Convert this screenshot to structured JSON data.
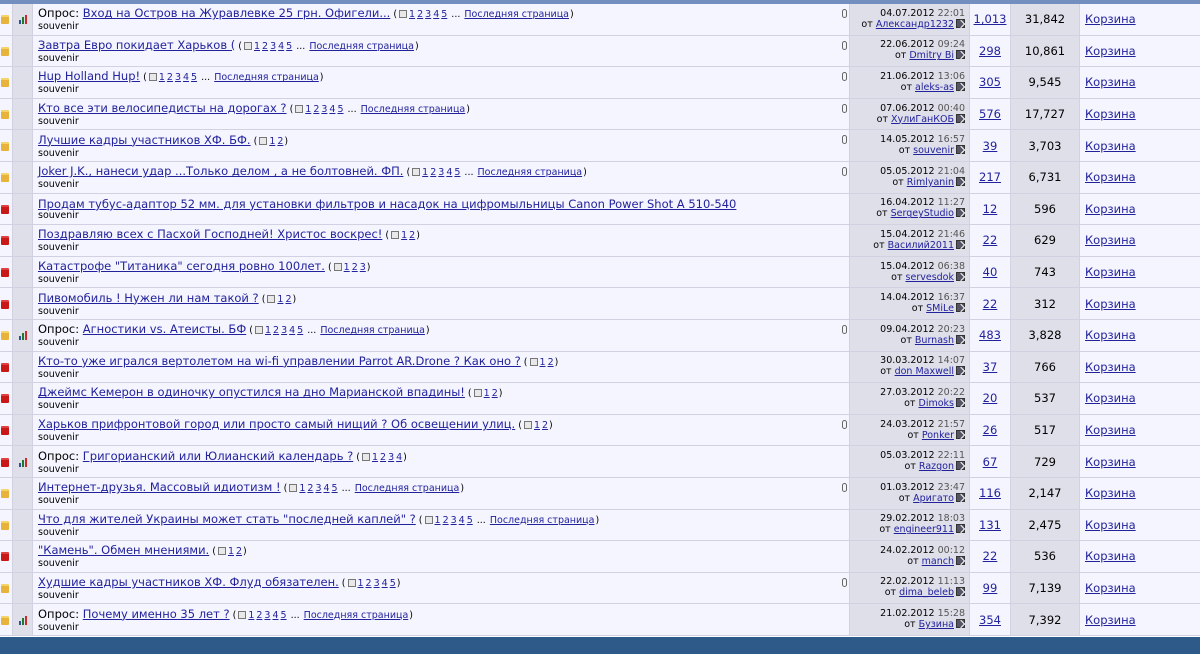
{
  "pages_word": "Последняя страница",
  "poll_prefix": "Опрос:",
  "by_prefix": "от",
  "threads": [
    {
      "poll": true,
      "hot": true,
      "clip": true,
      "title": "Вход на Остров на Журавлевке 25 грн. Офигели...",
      "pages": [
        "1",
        "2",
        "3",
        "4",
        "5"
      ],
      "has_last": true,
      "author": "souvenir",
      "date": "04.07.2012",
      "time": "22:01",
      "last_by": "Александр1232",
      "replies": "1,013",
      "views": "31,842",
      "category": "Корзина"
    },
    {
      "poll": false,
      "hot": true,
      "clip": true,
      "title": "Завтра Евро покидает Харьков (",
      "pages": [
        "1",
        "2",
        "3",
        "4",
        "5"
      ],
      "has_last": true,
      "author": "souvenir",
      "date": "22.06.2012",
      "time": "09:24",
      "last_by": "Dmitry Bi",
      "replies": "298",
      "views": "10,861",
      "category": "Корзина"
    },
    {
      "poll": false,
      "hot": true,
      "clip": true,
      "title": "Hup Holland Hup!",
      "pages": [
        "1",
        "2",
        "3",
        "4",
        "5"
      ],
      "has_last": true,
      "author": "souvenir",
      "date": "21.06.2012",
      "time": "13:06",
      "last_by": "aleks-as",
      "replies": "305",
      "views": "9,545",
      "category": "Корзина"
    },
    {
      "poll": false,
      "hot": true,
      "clip": true,
      "title": "Кто все эти велосипедисты на дорогах ?",
      "pages": [
        "1",
        "2",
        "3",
        "4",
        "5"
      ],
      "has_last": true,
      "author": "souvenir",
      "date": "07.06.2012",
      "time": "00:40",
      "last_by": "ХулиГанКОБ",
      "replies": "576",
      "views": "17,727",
      "category": "Корзина"
    },
    {
      "poll": false,
      "hot": true,
      "clip": true,
      "title": "Лучшие кадры участников ХФ. БФ.",
      "pages": [
        "1",
        "2"
      ],
      "has_last": false,
      "author": "souvenir",
      "date": "14.05.2012",
      "time": "16:57",
      "last_by": "souvenir",
      "replies": "39",
      "views": "3,703",
      "category": "Корзина"
    },
    {
      "poll": false,
      "hot": true,
      "clip": true,
      "title": "Joker J.K., нанеси удар ...Только делом , а не болтовней. ФП.",
      "pages": [
        "1",
        "2",
        "3",
        "4",
        "5"
      ],
      "has_last": true,
      "author": "souvenir",
      "date": "05.05.2012",
      "time": "21:04",
      "last_by": "Rimlyanin",
      "replies": "217",
      "views": "6,731",
      "category": "Корзина"
    },
    {
      "poll": false,
      "hot": false,
      "clip": false,
      "title": "Продам тубус-адаптор 52 мм. для установки фильтров и насадок на цифромыльницы Canon Power Shot A 510-540",
      "pages": [],
      "has_last": false,
      "author": "souvenir",
      "date": "16.04.2012",
      "time": "11:27",
      "last_by": "SergeyStudio",
      "replies": "12",
      "views": "596",
      "category": "Корзина"
    },
    {
      "poll": false,
      "hot": false,
      "clip": false,
      "title": "Поздравляю всех с Пасхой Господней! Христос воскрес!",
      "pages": [
        "1",
        "2"
      ],
      "has_last": false,
      "author": "souvenir",
      "date": "15.04.2012",
      "time": "21:46",
      "last_by": "Василий2011",
      "replies": "22",
      "views": "629",
      "category": "Корзина"
    },
    {
      "poll": false,
      "hot": false,
      "clip": false,
      "title": "Катастрофе \"Титаника\" сегодня ровно 100лет.",
      "pages": [
        "1",
        "2",
        "3"
      ],
      "has_last": false,
      "author": "souvenir",
      "date": "15.04.2012",
      "time": "06:38",
      "last_by": "servesdok",
      "replies": "40",
      "views": "743",
      "category": "Корзина"
    },
    {
      "poll": false,
      "hot": false,
      "clip": false,
      "title": "Пивомобиль ! Нужен ли нам такой ?",
      "pages": [
        "1",
        "2"
      ],
      "has_last": false,
      "author": "souvenir",
      "date": "14.04.2012",
      "time": "16:37",
      "last_by": "SMiLe",
      "replies": "22",
      "views": "312",
      "category": "Корзина"
    },
    {
      "poll": true,
      "hot": true,
      "clip": true,
      "title": "Агностики vs. Атеисты. БФ",
      "pages": [
        "1",
        "2",
        "3",
        "4",
        "5"
      ],
      "has_last": true,
      "author": "souvenir",
      "date": "09.04.2012",
      "time": "20:23",
      "last_by": "Burnash",
      "replies": "483",
      "views": "3,828",
      "category": "Корзина"
    },
    {
      "poll": false,
      "hot": false,
      "clip": false,
      "title": "Кто-то уже игрался вертолетом на wi-fi управлении Parrot AR.Drone ? Как оно ?",
      "pages": [
        "1",
        "2"
      ],
      "has_last": false,
      "author": "souvenir",
      "date": "30.03.2012",
      "time": "14:07",
      "last_by": "don Maxwell",
      "replies": "37",
      "views": "766",
      "category": "Корзина"
    },
    {
      "poll": false,
      "hot": false,
      "clip": false,
      "title": "Джеймс Кемерон в одиночку опустился на дно Марианской впадины!",
      "pages": [
        "1",
        "2"
      ],
      "has_last": false,
      "author": "souvenir",
      "date": "27.03.2012",
      "time": "20:22",
      "last_by": "Dimoks",
      "replies": "20",
      "views": "537",
      "category": "Корзина"
    },
    {
      "poll": false,
      "hot": false,
      "clip": true,
      "title": "Харьков прифронтовой город или просто самый нищий ? Об освещении улиц.",
      "pages": [
        "1",
        "2"
      ],
      "has_last": false,
      "author": "souvenir",
      "date": "24.03.2012",
      "time": "21:57",
      "last_by": "Ponker",
      "replies": "26",
      "views": "517",
      "category": "Корзина"
    },
    {
      "poll": true,
      "hot": false,
      "clip": false,
      "title": "Григорианский или Юлианский календарь ?",
      "pages": [
        "1",
        "2",
        "3",
        "4"
      ],
      "has_last": false,
      "author": "souvenir",
      "date": "05.03.2012",
      "time": "22:11",
      "last_by": "Razgon",
      "replies": "67",
      "views": "729",
      "category": "Корзина"
    },
    {
      "poll": false,
      "hot": true,
      "clip": true,
      "title": "Интернет-друзья. Массовый идиотизм !",
      "pages": [
        "1",
        "2",
        "3",
        "4",
        "5"
      ],
      "has_last": true,
      "author": "souvenir",
      "date": "01.03.2012",
      "time": "23:47",
      "last_by": "Аригато",
      "replies": "116",
      "views": "2,147",
      "category": "Корзина"
    },
    {
      "poll": false,
      "hot": true,
      "clip": false,
      "title": "Что для жителей Украины может стать \"последней каплей\" ?",
      "pages": [
        "1",
        "2",
        "3",
        "4",
        "5"
      ],
      "has_last": true,
      "author": "souvenir",
      "date": "29.02.2012",
      "time": "18:03",
      "last_by": "engineer911",
      "replies": "131",
      "views": "2,475",
      "category": "Корзина"
    },
    {
      "poll": false,
      "hot": false,
      "clip": false,
      "title": "\"Камень\". Обмен мнениями.",
      "pages": [
        "1",
        "2"
      ],
      "has_last": false,
      "author": "souvenir",
      "date": "24.02.2012",
      "time": "00:12",
      "last_by": "manch",
      "replies": "22",
      "views": "536",
      "category": "Корзина"
    },
    {
      "poll": false,
      "hot": true,
      "clip": true,
      "title": "Худшие кадры участников ХФ. Флуд обязателен.",
      "pages": [
        "1",
        "2",
        "3",
        "4",
        "5"
      ],
      "has_last": false,
      "author": "souvenir",
      "date": "22.02.2012",
      "time": "11:13",
      "last_by": "dima_beleb",
      "replies": "99",
      "views": "7,139",
      "category": "Корзина"
    },
    {
      "poll": true,
      "hot": true,
      "clip": false,
      "title": "Почему именно 35 лет ?",
      "pages": [
        "1",
        "2",
        "3",
        "4",
        "5"
      ],
      "has_last": true,
      "author": "souvenir",
      "date": "21.02.2012",
      "time": "15:28",
      "last_by": "Бузина",
      "replies": "354",
      "views": "7,392",
      "category": "Корзина"
    }
  ]
}
